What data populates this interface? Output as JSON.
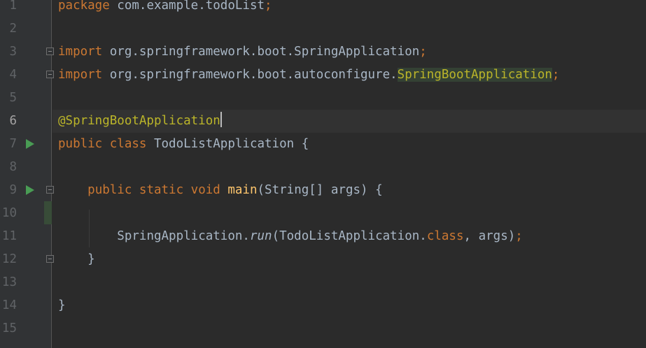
{
  "editor": {
    "line_numbers": [
      "1",
      "2",
      "3",
      "4",
      "5",
      "6",
      "7",
      "8",
      "9",
      "10",
      "11",
      "12",
      "13",
      "14",
      "15"
    ],
    "active_line": "6",
    "gutter_icons": {
      "run_line_7": "run-icon",
      "run_line_9": "run-icon",
      "fold_line_3": "fold-icon",
      "fold_line_4": "fold-icon",
      "fold_line_9": "fold-icon",
      "fold_line_12": "fold-icon"
    },
    "lines": {
      "l1": {
        "kw": "package",
        "rest": " com.example.todoList",
        "semi": ";"
      },
      "l3": {
        "kw": "import",
        "rest": " org.springframework.boot.SpringApplication",
        "semi": ";"
      },
      "l4": {
        "kw": "import",
        "rest": " org.springframework.boot.autoconfigure.",
        "hl": "SpringBootApplication",
        "semi": ";"
      },
      "l6": {
        "ann": "@SpringBootApplication"
      },
      "l7": {
        "kw": "public class",
        "rest": " TodoListApplication {"
      },
      "l9": {
        "indent": "    ",
        "kw": "public static void",
        "sp": " ",
        "fn": "main",
        "rest": "(String[] args) {"
      },
      "l11": {
        "indent": "        ",
        "a": "SpringApplication.",
        "it": "run",
        "b": "(TodoListApplication.",
        "kw": "class",
        "c": ", args)",
        "semi": ";"
      },
      "l12": {
        "text": "    }"
      },
      "l14": {
        "text": "}"
      }
    },
    "colors": {
      "background": "#2b2b2b",
      "gutter": "#313335",
      "keyword": "#cc7832",
      "annotation": "#bbb529",
      "method": "#ffc66d",
      "text": "#a9b7c6",
      "run_icon": "#499c54"
    }
  }
}
